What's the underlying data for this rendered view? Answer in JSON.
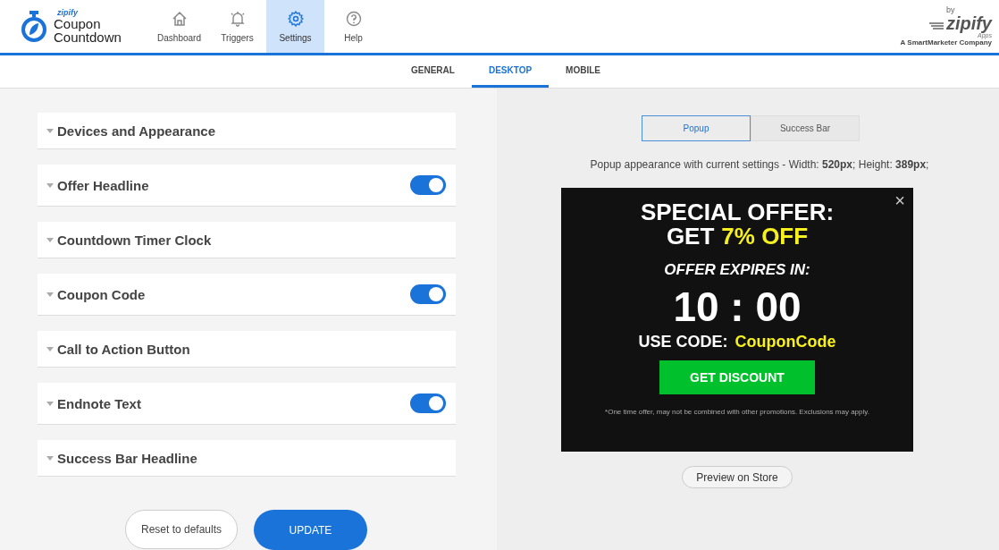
{
  "brand": {
    "small": "zipify",
    "line1": "Coupon",
    "line2": "Countdown"
  },
  "nav": [
    {
      "label": "Dashboard",
      "kind": "home",
      "selected": false
    },
    {
      "label": "Triggers",
      "kind": "bell",
      "selected": false
    },
    {
      "label": "Settings",
      "kind": "gear",
      "selected": true
    },
    {
      "label": "Help",
      "kind": "help",
      "selected": false
    }
  ],
  "partner": {
    "by": "by",
    "name": "zipify",
    "sub": "Apps",
    "tagline": "A SmartMarketer Company"
  },
  "tabs": [
    {
      "label": "GENERAL",
      "selected": false
    },
    {
      "label": "DESKTOP",
      "selected": true
    },
    {
      "label": "MOBILE",
      "selected": false
    }
  ],
  "sections": [
    {
      "title": "Devices and Appearance",
      "kind": "plain"
    },
    {
      "title": "Offer Headline",
      "kind": "toggle",
      "on": true
    },
    {
      "title": "Countdown Timer Clock",
      "kind": "plain"
    },
    {
      "title": "Coupon Code",
      "kind": "toggle",
      "on": true
    },
    {
      "title": "Call to Action Button",
      "kind": "plain"
    },
    {
      "title": "Endnote Text",
      "kind": "toggle",
      "on": true
    },
    {
      "title": "Success Bar Headline",
      "kind": "plain"
    }
  ],
  "actions": {
    "reset": "Reset to defaults",
    "update": "UPDATE"
  },
  "preview_tabs": [
    {
      "label": "Popup",
      "selected": true
    },
    {
      "label": "Success Bar",
      "selected": false
    }
  ],
  "preview_note": "Popup appearance with current settings - Width: **520px**; Height: **389px**;",
  "popup": {
    "close": "×",
    "headline1": "SPECIAL OFFER:",
    "headline2_prefix": "GET",
    "headline2_accent": "7% OFF",
    "expires": "OFFER EXPIRES IN:",
    "timer": "10 : 00",
    "code_label": "USE CODE:",
    "code": "CouponCode",
    "button": "GET DISCOUNT",
    "endnote": "*One time offer, may not be combined with other promotions. Exclusions may apply."
  },
  "preview_button": "Preview on Store"
}
